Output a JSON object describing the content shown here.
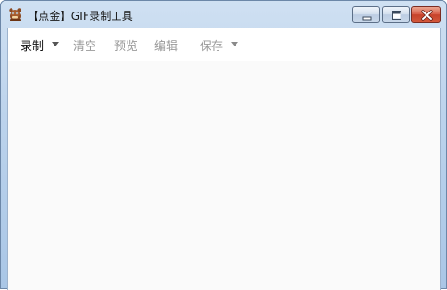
{
  "window": {
    "title": "【点金】GIF录制工具",
    "icon": "app-mascot-icon",
    "controls": {
      "minimize": "minimize-icon",
      "maximize": "maximize-icon",
      "close": "close-icon"
    }
  },
  "menubar": {
    "items": [
      {
        "label": "录制",
        "enabled": true,
        "has_dropdown": true
      },
      {
        "label": "清空",
        "enabled": false,
        "has_dropdown": false
      },
      {
        "label": "预览",
        "enabled": false,
        "has_dropdown": false
      },
      {
        "label": "编辑",
        "enabled": false,
        "has_dropdown": false
      },
      {
        "label": "保存",
        "enabled": false,
        "has_dropdown": true
      }
    ]
  },
  "colors": {
    "titlebar": "#bcd3ec",
    "client_background": "#fafafa",
    "menubar_background": "#ffffff",
    "active_text": "#111111",
    "disabled_text": "#9a9a9a",
    "close_button": "#c6422a"
  }
}
